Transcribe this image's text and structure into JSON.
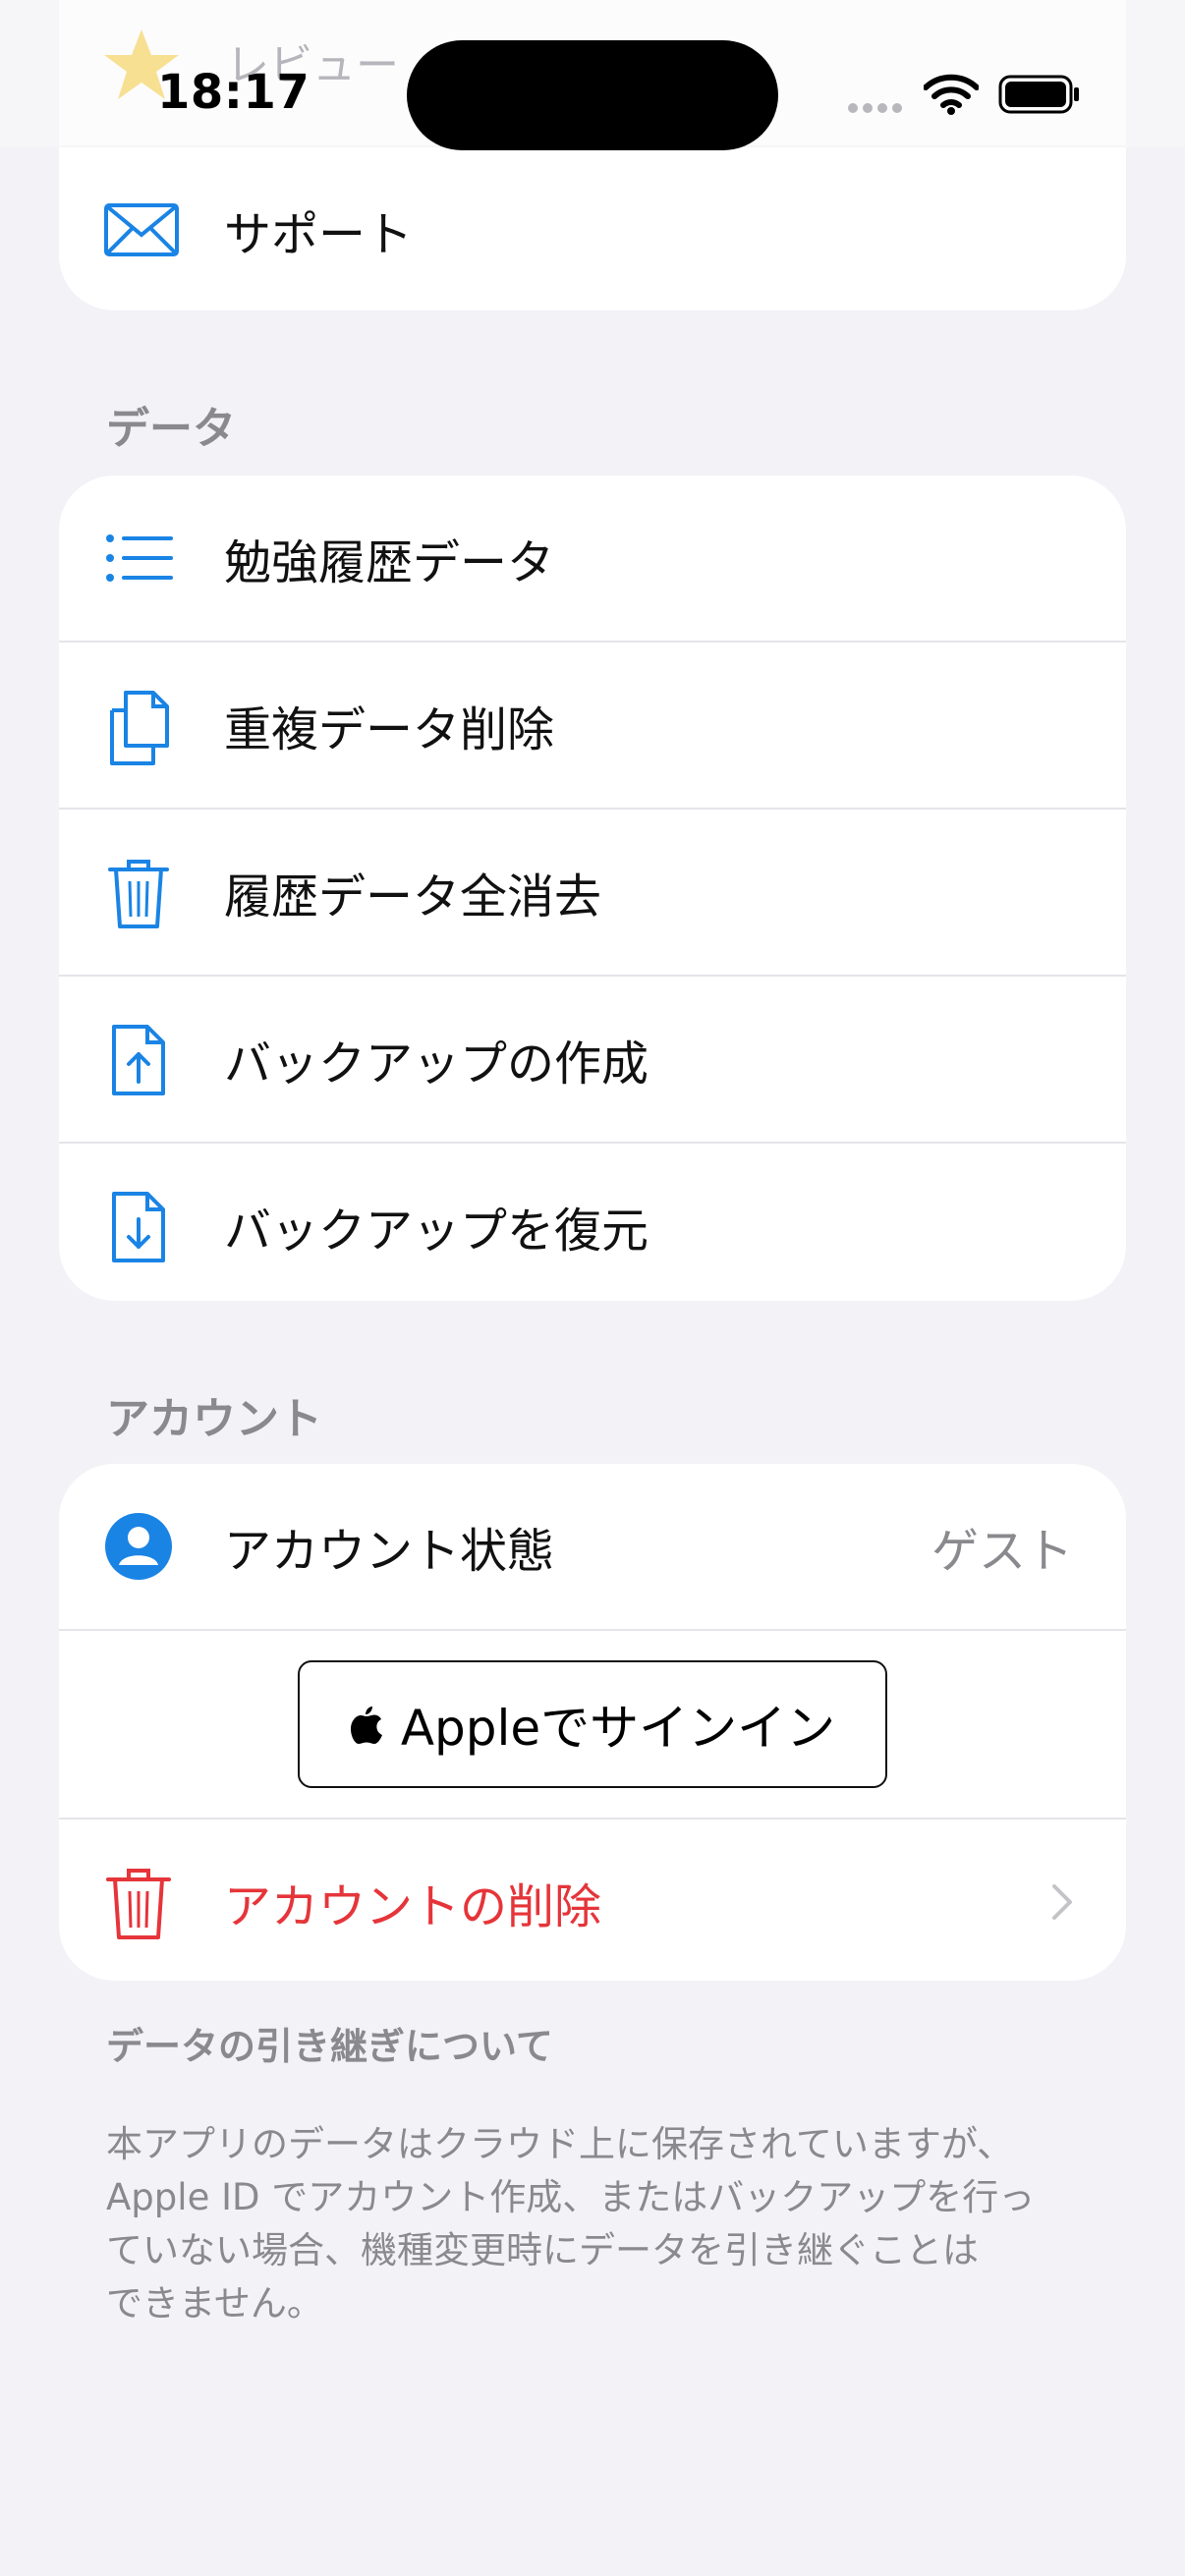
{
  "status_bar": {
    "time": "18:17"
  },
  "top_group": {
    "review_label": "レビュー",
    "support_label": "サポート"
  },
  "data_section": {
    "header": "データ",
    "items": [
      {
        "label": "勉強履歴データ",
        "icon": "list-icon"
      },
      {
        "label": "重複データ削除",
        "icon": "documents-duplicate-icon"
      },
      {
        "label": "履歴データ全消去",
        "icon": "trash-icon"
      },
      {
        "label": "バックアップの作成",
        "icon": "document-upload-icon"
      },
      {
        "label": "バックアップを復元",
        "icon": "document-download-icon"
      }
    ]
  },
  "account_section": {
    "header": "アカウント",
    "status_label": "アカウント状態",
    "status_value": "ゲスト",
    "signin_label": "Appleでサインイン",
    "delete_label": "アカウントの削除"
  },
  "footer": {
    "title": "データの引き継ぎについて",
    "lines": [
      "本アプリのデータはクラウド上に保存されていますが、",
      "Apple ID でアカウント作成、またはバックアップを行っ",
      "ていない場合、機種変更時にデータを引き継ぐことは",
      "できません。"
    ]
  },
  "colors": {
    "accent": "#1a84e5",
    "destructive": "#e5353a",
    "background": "#f2f2f7",
    "secondary_text": "#8a8a8e"
  }
}
